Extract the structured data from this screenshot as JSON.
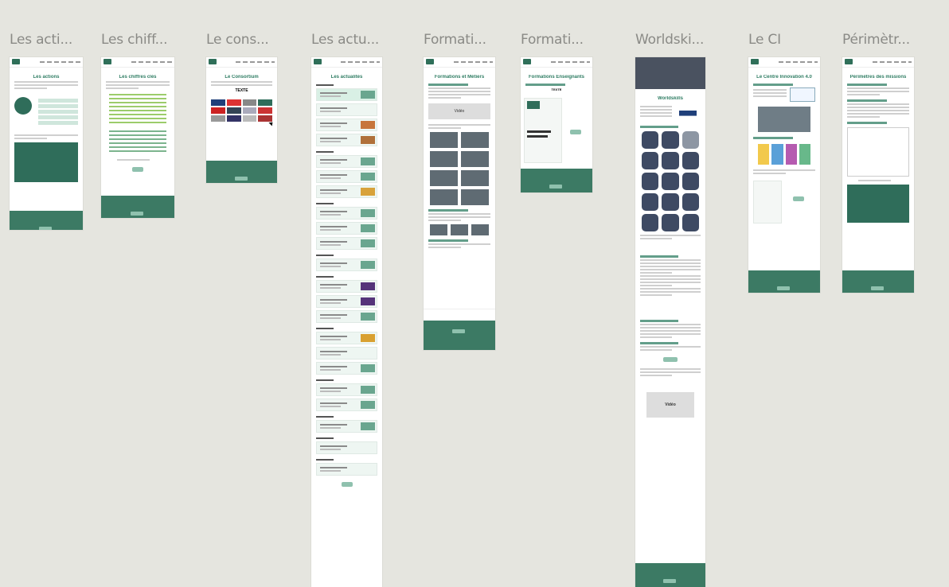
{
  "frames": [
    {
      "label": "Les acti...",
      "title": "Les actions"
    },
    {
      "label": "Les chiff...",
      "title": "Les chiffres clés"
    },
    {
      "label": "Le cons...",
      "title": "Le Consortium",
      "placeholder": "TEXTE"
    },
    {
      "label": "Les actu...",
      "title": "Les actualités"
    },
    {
      "label": "Formati...",
      "title": "Formations et Métiers",
      "box_label": "Vidéo"
    },
    {
      "label": "Formati...",
      "title": "Formations Enseignants",
      "placeholder": "TEXTE"
    },
    {
      "label": "Worldski...",
      "title": "Worldskills",
      "box_label": "Vidéo"
    },
    {
      "label": "Le CI",
      "title": "Le Centre Innovation 4.0"
    },
    {
      "label": "Périmètr...",
      "title": "Périmètres des missions"
    }
  ],
  "colors": {
    "canvas": "#e5e5df",
    "brand_green": "#2f7d63",
    "footer_green": "#3c7a64"
  }
}
